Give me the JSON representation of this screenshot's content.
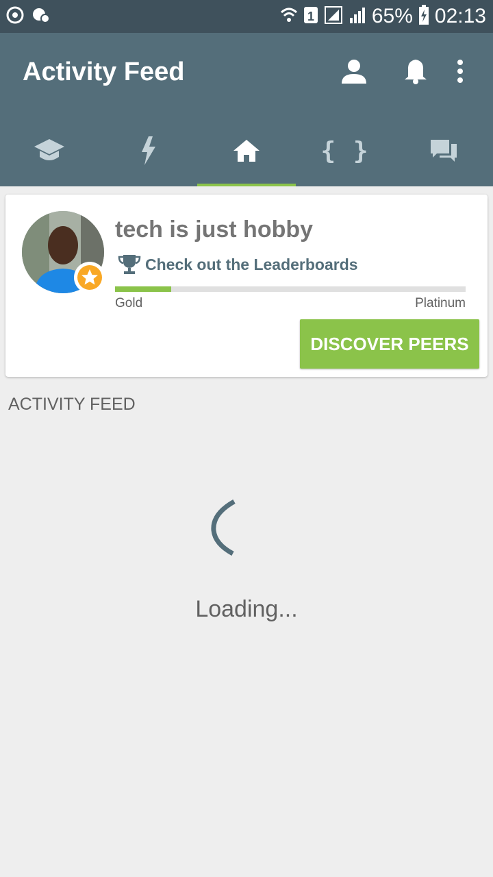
{
  "status_bar": {
    "battery": "65%",
    "time": "02:13",
    "sim_slot": "1",
    "icons": [
      "sync-icon",
      "vpn-key-icon",
      "wifi-icon",
      "sim-icon",
      "signal-icon",
      "battery-charging-icon"
    ]
  },
  "app_bar": {
    "title": "Activity Feed",
    "actions": [
      "profile-icon",
      "notifications-icon",
      "more-vert-icon"
    ]
  },
  "tabs": [
    {
      "name": "learn",
      "icon": "graduation-cap-icon",
      "active": false
    },
    {
      "name": "quick",
      "icon": "lightning-icon",
      "active": false
    },
    {
      "name": "home",
      "icon": "home-icon",
      "active": true
    },
    {
      "name": "code",
      "icon": "braces-icon",
      "glyph": "{ }",
      "active": false
    },
    {
      "name": "discuss",
      "icon": "chat-bubbles-icon",
      "active": false
    }
  ],
  "profile_card": {
    "user_name": "tech is just hobby",
    "leaderboard_link": "Check out the Leaderboards",
    "rank_current": "Gold",
    "rank_next": "Platinum",
    "progress_fraction": 0.16,
    "discover_button": "DISCOVER PEERS"
  },
  "feed": {
    "section_label": "ACTIVITY FEED",
    "loading_text": "Loading..."
  },
  "colors": {
    "app_bar": "#546e7a",
    "status_bar": "#3f515c",
    "accent": "#8bc34a",
    "background": "#eeeeee"
  }
}
